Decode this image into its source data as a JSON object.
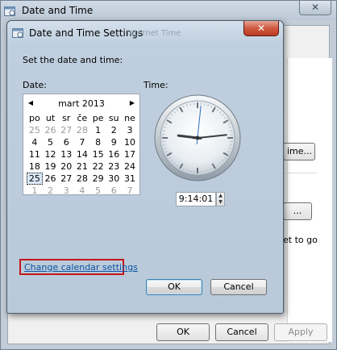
{
  "parent": {
    "title": "Date and Time",
    "change_btn": "ime...",
    "mid_btn": "...",
    "side_text": "et to go",
    "footer": {
      "ok": "OK",
      "cancel": "Cancel",
      "apply": "Apply"
    }
  },
  "dialog": {
    "title": "Date and Time Settings",
    "ghost_text": "Internet Time",
    "close_label": "✕",
    "instruction": "Set the date and time:",
    "date_label": "Date:",
    "time_label": "Time:",
    "calendar": {
      "month": "mart 2013",
      "prev": "◀",
      "next": "▶",
      "weekdays": [
        "po",
        "ut",
        "sr",
        "če",
        "pe",
        "su",
        "ne"
      ],
      "weeks": [
        [
          {
            "d": "25",
            "o": true
          },
          {
            "d": "26",
            "o": true
          },
          {
            "d": "27",
            "o": true
          },
          {
            "d": "28",
            "o": true
          },
          {
            "d": "1"
          },
          {
            "d": "2"
          },
          {
            "d": "3"
          }
        ],
        [
          {
            "d": "4"
          },
          {
            "d": "5"
          },
          {
            "d": "6"
          },
          {
            "d": "7"
          },
          {
            "d": "8"
          },
          {
            "d": "9"
          },
          {
            "d": "10"
          }
        ],
        [
          {
            "d": "11"
          },
          {
            "d": "12"
          },
          {
            "d": "13"
          },
          {
            "d": "14"
          },
          {
            "d": "15"
          },
          {
            "d": "16"
          },
          {
            "d": "17"
          }
        ],
        [
          {
            "d": "18"
          },
          {
            "d": "19"
          },
          {
            "d": "20"
          },
          {
            "d": "21"
          },
          {
            "d": "22"
          },
          {
            "d": "23"
          },
          {
            "d": "24"
          }
        ],
        [
          {
            "d": "25",
            "sel": true
          },
          {
            "d": "26"
          },
          {
            "d": "27"
          },
          {
            "d": "28"
          },
          {
            "d": "29"
          },
          {
            "d": "30"
          },
          {
            "d": "31"
          }
        ],
        [
          {
            "d": "1",
            "o": true
          },
          {
            "d": "2",
            "o": true
          },
          {
            "d": "3",
            "o": true
          },
          {
            "d": "4",
            "o": true
          },
          {
            "d": "5",
            "o": true
          },
          {
            "d": "6",
            "o": true
          },
          {
            "d": "7",
            "o": true
          }
        ]
      ]
    },
    "time_value": "9:14:01",
    "clock": {
      "hours": 9,
      "minutes": 14,
      "seconds": 1
    },
    "link": "Change calendar settings",
    "ok": "OK",
    "cancel": "Cancel",
    "highlight_color": "#c4161c"
  }
}
